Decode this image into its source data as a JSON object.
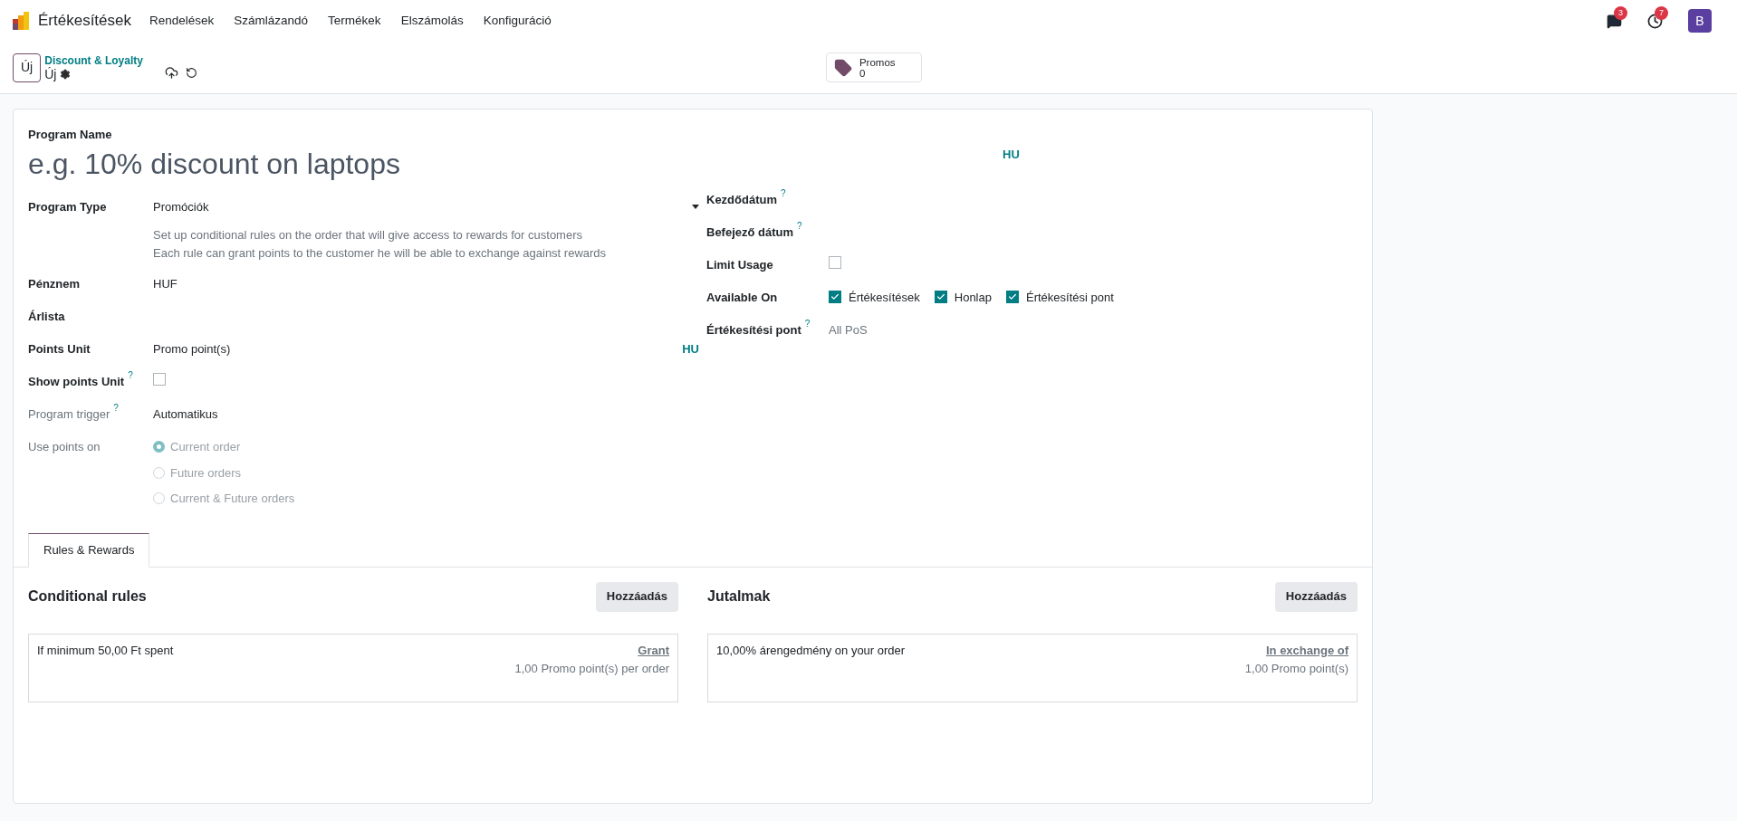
{
  "navbar": {
    "app": "Értékesítések",
    "menu": [
      "Rendelések",
      "Számlázandó",
      "Termékek",
      "Elszámolás",
      "Konfiguráció"
    ],
    "messages_count": "3",
    "activities_count": "7",
    "avatar": "B"
  },
  "control_panel": {
    "new_button": "Új",
    "breadcrumb": "Discount & Loyalty",
    "record": "Új",
    "smart_button": {
      "label": "Promos",
      "value": "0"
    }
  },
  "form": {
    "name_label": "Program Name",
    "name_placeholder": "e.g. 10% discount on laptops",
    "name_lang": "HU",
    "left": [
      {
        "kind": "select",
        "label": "Program Type",
        "value": "Promóciók",
        "help": [
          "Set up conditional rules on the order that will give access to rewards for customers",
          "Each rule can grant points to the customer he will be able to exchange against rewards"
        ]
      },
      {
        "kind": "text",
        "label": "Pénznem",
        "value": "HUF"
      },
      {
        "kind": "text",
        "label": "Árlista"
      },
      {
        "kind": "translatable",
        "label": "Points Unit",
        "value": "Promo point(s)",
        "lang": "HU"
      },
      {
        "kind": "checkbox",
        "label": "Show points Unit",
        "tooltip": "?",
        "checked": false
      },
      {
        "kind": "text",
        "label": "Program trigger",
        "tooltip": "?",
        "value": "Automatikus",
        "disabled": true
      },
      {
        "kind": "radio",
        "label": "Use points on",
        "disabled": true,
        "options": [
          {
            "label": "Current order",
            "selected": true
          },
          {
            "label": "Future orders",
            "selected": false
          },
          {
            "label": "Current & Future orders",
            "selected": false
          }
        ]
      }
    ],
    "right": [
      {
        "kind": "text",
        "label": "Kezdődátum",
        "tooltip": "?"
      },
      {
        "kind": "text",
        "label": "Befejező dátum",
        "tooltip": "?"
      },
      {
        "kind": "checkbox",
        "label": "Limit Usage",
        "checked": false
      },
      {
        "kind": "checks",
        "label": "Available On",
        "options": [
          {
            "label": "Értékesítések",
            "checked": true
          },
          {
            "label": "Honlap",
            "checked": true
          },
          {
            "label": "Értékesítési pont",
            "checked": true
          }
        ]
      },
      {
        "kind": "text",
        "label": "Értékesítési pont",
        "tooltip": "?",
        "placeholder": "All PoS"
      }
    ]
  },
  "tabs": [
    {
      "label": "Rules & Rewards",
      "selected": true
    }
  ],
  "sections": [
    {
      "title": "Conditional rules",
      "button": "Hozzáadás",
      "card": {
        "text": "If minimum 50,00 Ft spent",
        "link": "Grant",
        "detail": "1,00 Promo point(s) per order"
      }
    },
    {
      "title": "Jutalmak",
      "button": "Hozzáadás",
      "card": {
        "text": "10,00% árengedmény on your order",
        "link": "In exchange of",
        "detail": "1,00 Promo point(s)"
      }
    }
  ]
}
